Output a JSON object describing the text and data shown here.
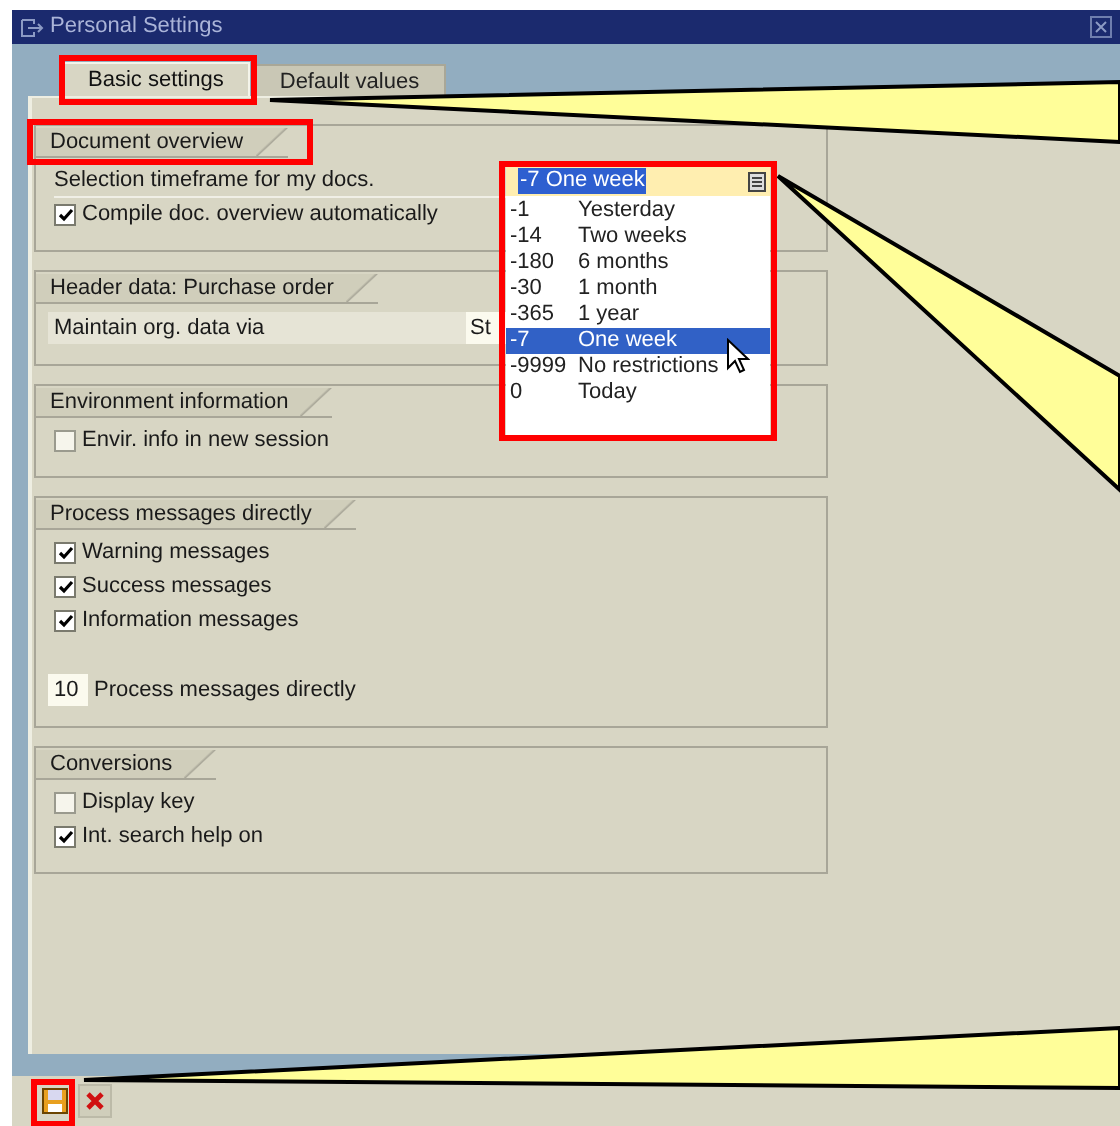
{
  "window": {
    "title": "Personal Settings"
  },
  "tabs": [
    {
      "label": "Basic settings",
      "selected": true
    },
    {
      "label": "Default values",
      "selected": false
    }
  ],
  "groups": [
    {
      "title": "Document overview",
      "rows": [
        {
          "kind": "dropdown",
          "label": "Selection timeframe for my docs."
        },
        {
          "kind": "checkbox",
          "label": "Compile doc. overview automatically",
          "checked": true
        }
      ]
    },
    {
      "title": "Header data: Purchase order",
      "rows": [
        {
          "kind": "field",
          "label": "Maintain org. data via",
          "value": "St"
        }
      ]
    },
    {
      "title": "Environment information",
      "rows": [
        {
          "kind": "checkbox",
          "label": "Envir. info in new session",
          "checked": false
        }
      ]
    },
    {
      "title": "Process messages directly",
      "rows": [
        {
          "kind": "checkbox",
          "label": "Warning messages",
          "checked": true
        },
        {
          "kind": "checkbox",
          "label": "Success messages",
          "checked": true
        },
        {
          "kind": "checkbox",
          "label": "Information messages",
          "checked": true
        },
        {
          "kind": "number",
          "value": "10",
          "label": "Process messages directly"
        }
      ]
    },
    {
      "title": "Conversions",
      "rows": [
        {
          "kind": "checkbox",
          "label": "Display key",
          "checked": false
        },
        {
          "kind": "checkbox",
          "label": "Int. search help on",
          "checked": true
        }
      ]
    }
  ],
  "dropdown": {
    "value": "-7 One week",
    "options": [
      {
        "code": "-1",
        "label": "Yesterday",
        "selected": false
      },
      {
        "code": "-14",
        "label": "Two weeks",
        "selected": false
      },
      {
        "code": "-180",
        "label": "6 months",
        "selected": false
      },
      {
        "code": "-30",
        "label": "1 month",
        "selected": false
      },
      {
        "code": "-365",
        "label": "1 year",
        "selected": false
      },
      {
        "code": "-7",
        "label": "One week",
        "selected": true
      },
      {
        "code": "-9999",
        "label": "No restrictions",
        "selected": false
      },
      {
        "code": "0",
        "label": "Today",
        "selected": false
      }
    ]
  },
  "toolbar": [
    {
      "kind": "save"
    },
    {
      "kind": "cancel"
    }
  ]
}
